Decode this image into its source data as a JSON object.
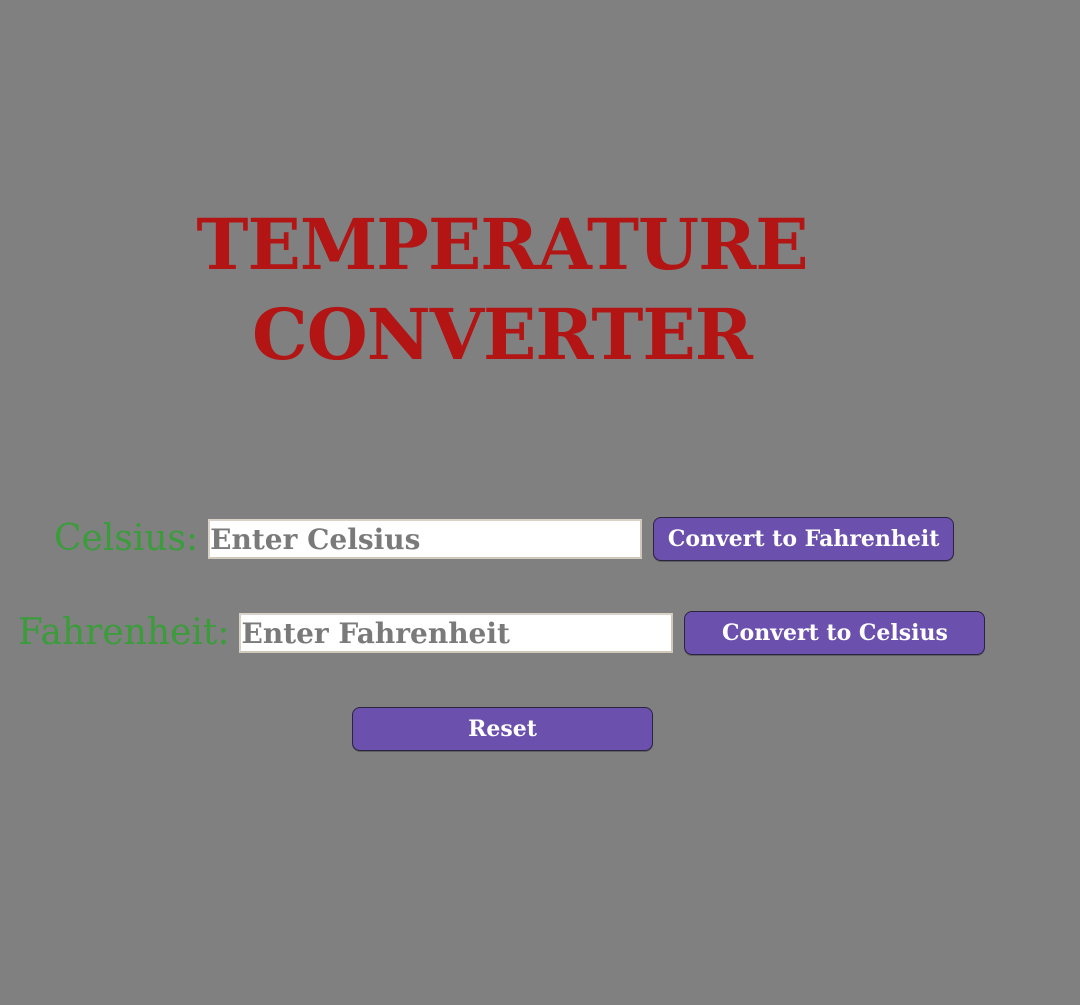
{
  "title": {
    "line1": "TEMPERATURE",
    "line2": "CONVERTER"
  },
  "celsius": {
    "label": "Celsius:",
    "placeholder": "Enter Celsius",
    "value": "",
    "button_label": "Convert to Fahrenheit"
  },
  "fahrenheit": {
    "label": "Fahrenheit:",
    "placeholder": "Enter Fahrenheit",
    "value": "",
    "button_label": "Convert to Celsius"
  },
  "reset": {
    "label": "Reset"
  },
  "colors": {
    "background": "#808080",
    "title": "#b31414",
    "label": "#3a9c3a",
    "button": "#6b50ad",
    "button_text": "#ffffff"
  }
}
